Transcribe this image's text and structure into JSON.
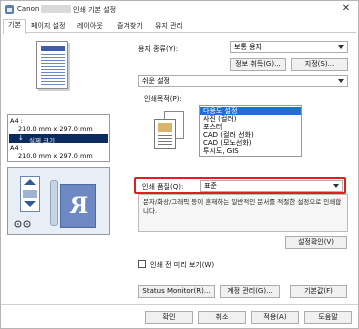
{
  "window": {
    "title_left": "Canon",
    "title_right": "인쇄 기본 설정",
    "close_glyph": "✕"
  },
  "tabs": [
    {
      "label": "기본"
    },
    {
      "label": "페이지 설정"
    },
    {
      "label": "레이아웃"
    },
    {
      "label": "즐겨찾기"
    },
    {
      "label": "유지 관리"
    }
  ],
  "paper_info": {
    "line1": "A4 :",
    "line2": "210.0 mm x 297.0 mm",
    "selected": "실제 크기",
    "selected_arrow": "↓",
    "line3": "A4 :",
    "line4": "210.0 mm x 297.0 mm"
  },
  "orientation_glyph": "R",
  "media": {
    "label": "용지 종류(Y):",
    "value": "보통 용지"
  },
  "buttons": {
    "info": "정보 취득(G)...",
    "specify": "지정(S)...",
    "quality_confirm": "설정확인(V)",
    "status_monitor": "Status Monitor(R)...",
    "account": "계정 관리(G)...",
    "defaults": "기본값(F)",
    "ok": "확인",
    "cancel": "취소",
    "apply": "적용(A)",
    "help": "도움말"
  },
  "setup_mode": {
    "value": "쉬운 설정"
  },
  "purpose": {
    "label": "인쇄목적(P):",
    "items": [
      "다용도 설정",
      "사진 (컬러)",
      "포스터",
      "CAD (컬러 선화)",
      "CAD (모노선화)",
      "투시도, GIS"
    ],
    "selected_index": 0
  },
  "quality": {
    "label": "인쇄 품질(Q):",
    "value": "표준",
    "description": "문자/화상/그래픽 등이 혼재하는 일반적인 문서를 적절한 설정으로 인쇄합니다."
  },
  "preview_check": {
    "label": "인쇄 전 미리 보기(W)",
    "checked": false
  },
  "colors": {
    "highlight": "#e02020",
    "selection": "#1f6fd6",
    "dark_selection": "#0b2a5e"
  }
}
